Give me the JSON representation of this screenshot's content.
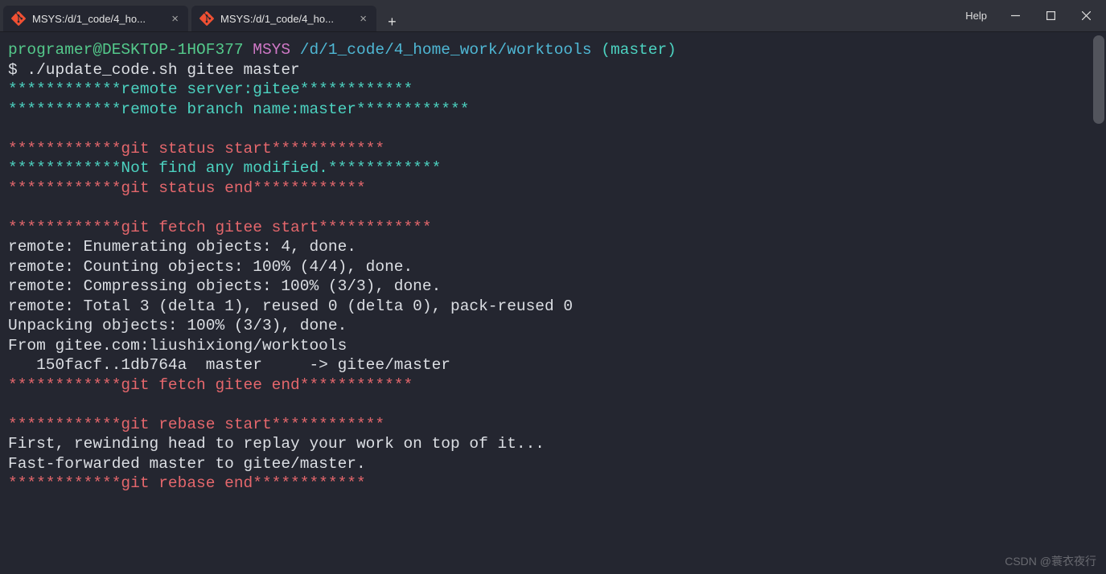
{
  "titlebar": {
    "tabs": [
      {
        "title": "MSYS:/d/1_code/4_ho...",
        "icon": "git"
      },
      {
        "title": "MSYS:/d/1_code/4_ho...",
        "icon": "git"
      }
    ],
    "help_label": "Help"
  },
  "prompt": {
    "user_host": "programer@DESKTOP-1HOF377",
    "shell": "MSYS",
    "cwd": "/d/1_code/4_home_work/worktools",
    "branch": "(master)",
    "symbol": "$",
    "command": "./update_code.sh gitee master"
  },
  "lines": {
    "info_server": "************remote server:gitee************",
    "info_branch": "************remote branch name:master************",
    "status_start": "************git status start************",
    "status_none": "************Not find any modified.************",
    "status_end": "************git status end************",
    "fetch_start": "************git fetch gitee start************",
    "remote1": "remote: Enumerating objects: 4, done.",
    "remote2": "remote: Counting objects: 100% (4/4), done.",
    "remote3": "remote: Compressing objects: 100% (3/3), done.",
    "remote4": "remote: Total 3 (delta 1), reused 0 (delta 0), pack-reused 0",
    "unpack": "Unpacking objects: 100% (3/3), done.",
    "from": "From gitee.com:liushixiong/worktools",
    "ref": "   150facf..1db764a  master     -> gitee/master",
    "fetch_end": "************git fetch gitee end************",
    "rebase_start": "************git rebase start************",
    "rewind": "First, rewinding head to replay your work on top of it...",
    "ff": "Fast-forwarded master to gitee/master.",
    "rebase_end": "************git rebase end************"
  },
  "watermark": "CSDN @蓑衣夜行"
}
